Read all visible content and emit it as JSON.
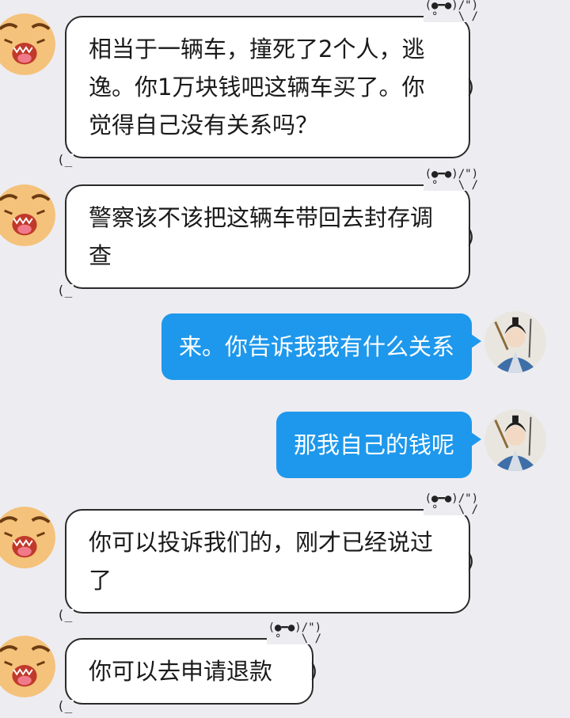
{
  "messages": [
    {
      "side": "in",
      "text": "相当于一辆车，撞死了2个人，逃逸。你1万块钱吧这辆车买了。你觉得自己没有关系吗？"
    },
    {
      "side": "in",
      "text": "警察该不该把这辆车带回去封存调查"
    },
    {
      "side": "out",
      "text": "来。你告诉我我有什么关系"
    },
    {
      "side": "out",
      "text": "那我自己的钱呢"
    },
    {
      "side": "in",
      "text": "你可以投诉我们的，刚才已经说过了"
    },
    {
      "side": "in",
      "text": "你可以去申请退款"
    }
  ],
  "bubble_decoration": {
    "top": "(●━●)/\")\n °   \\ /",
    "bottom_left": "(_",
    "right": ")"
  },
  "avatars": {
    "other": "tiger-avatar",
    "self": "swordsman-avatar"
  },
  "colors": {
    "background": "#edecf1",
    "outgoing_bubble": "#1e98ec",
    "incoming_bubble": "#ffffff"
  }
}
